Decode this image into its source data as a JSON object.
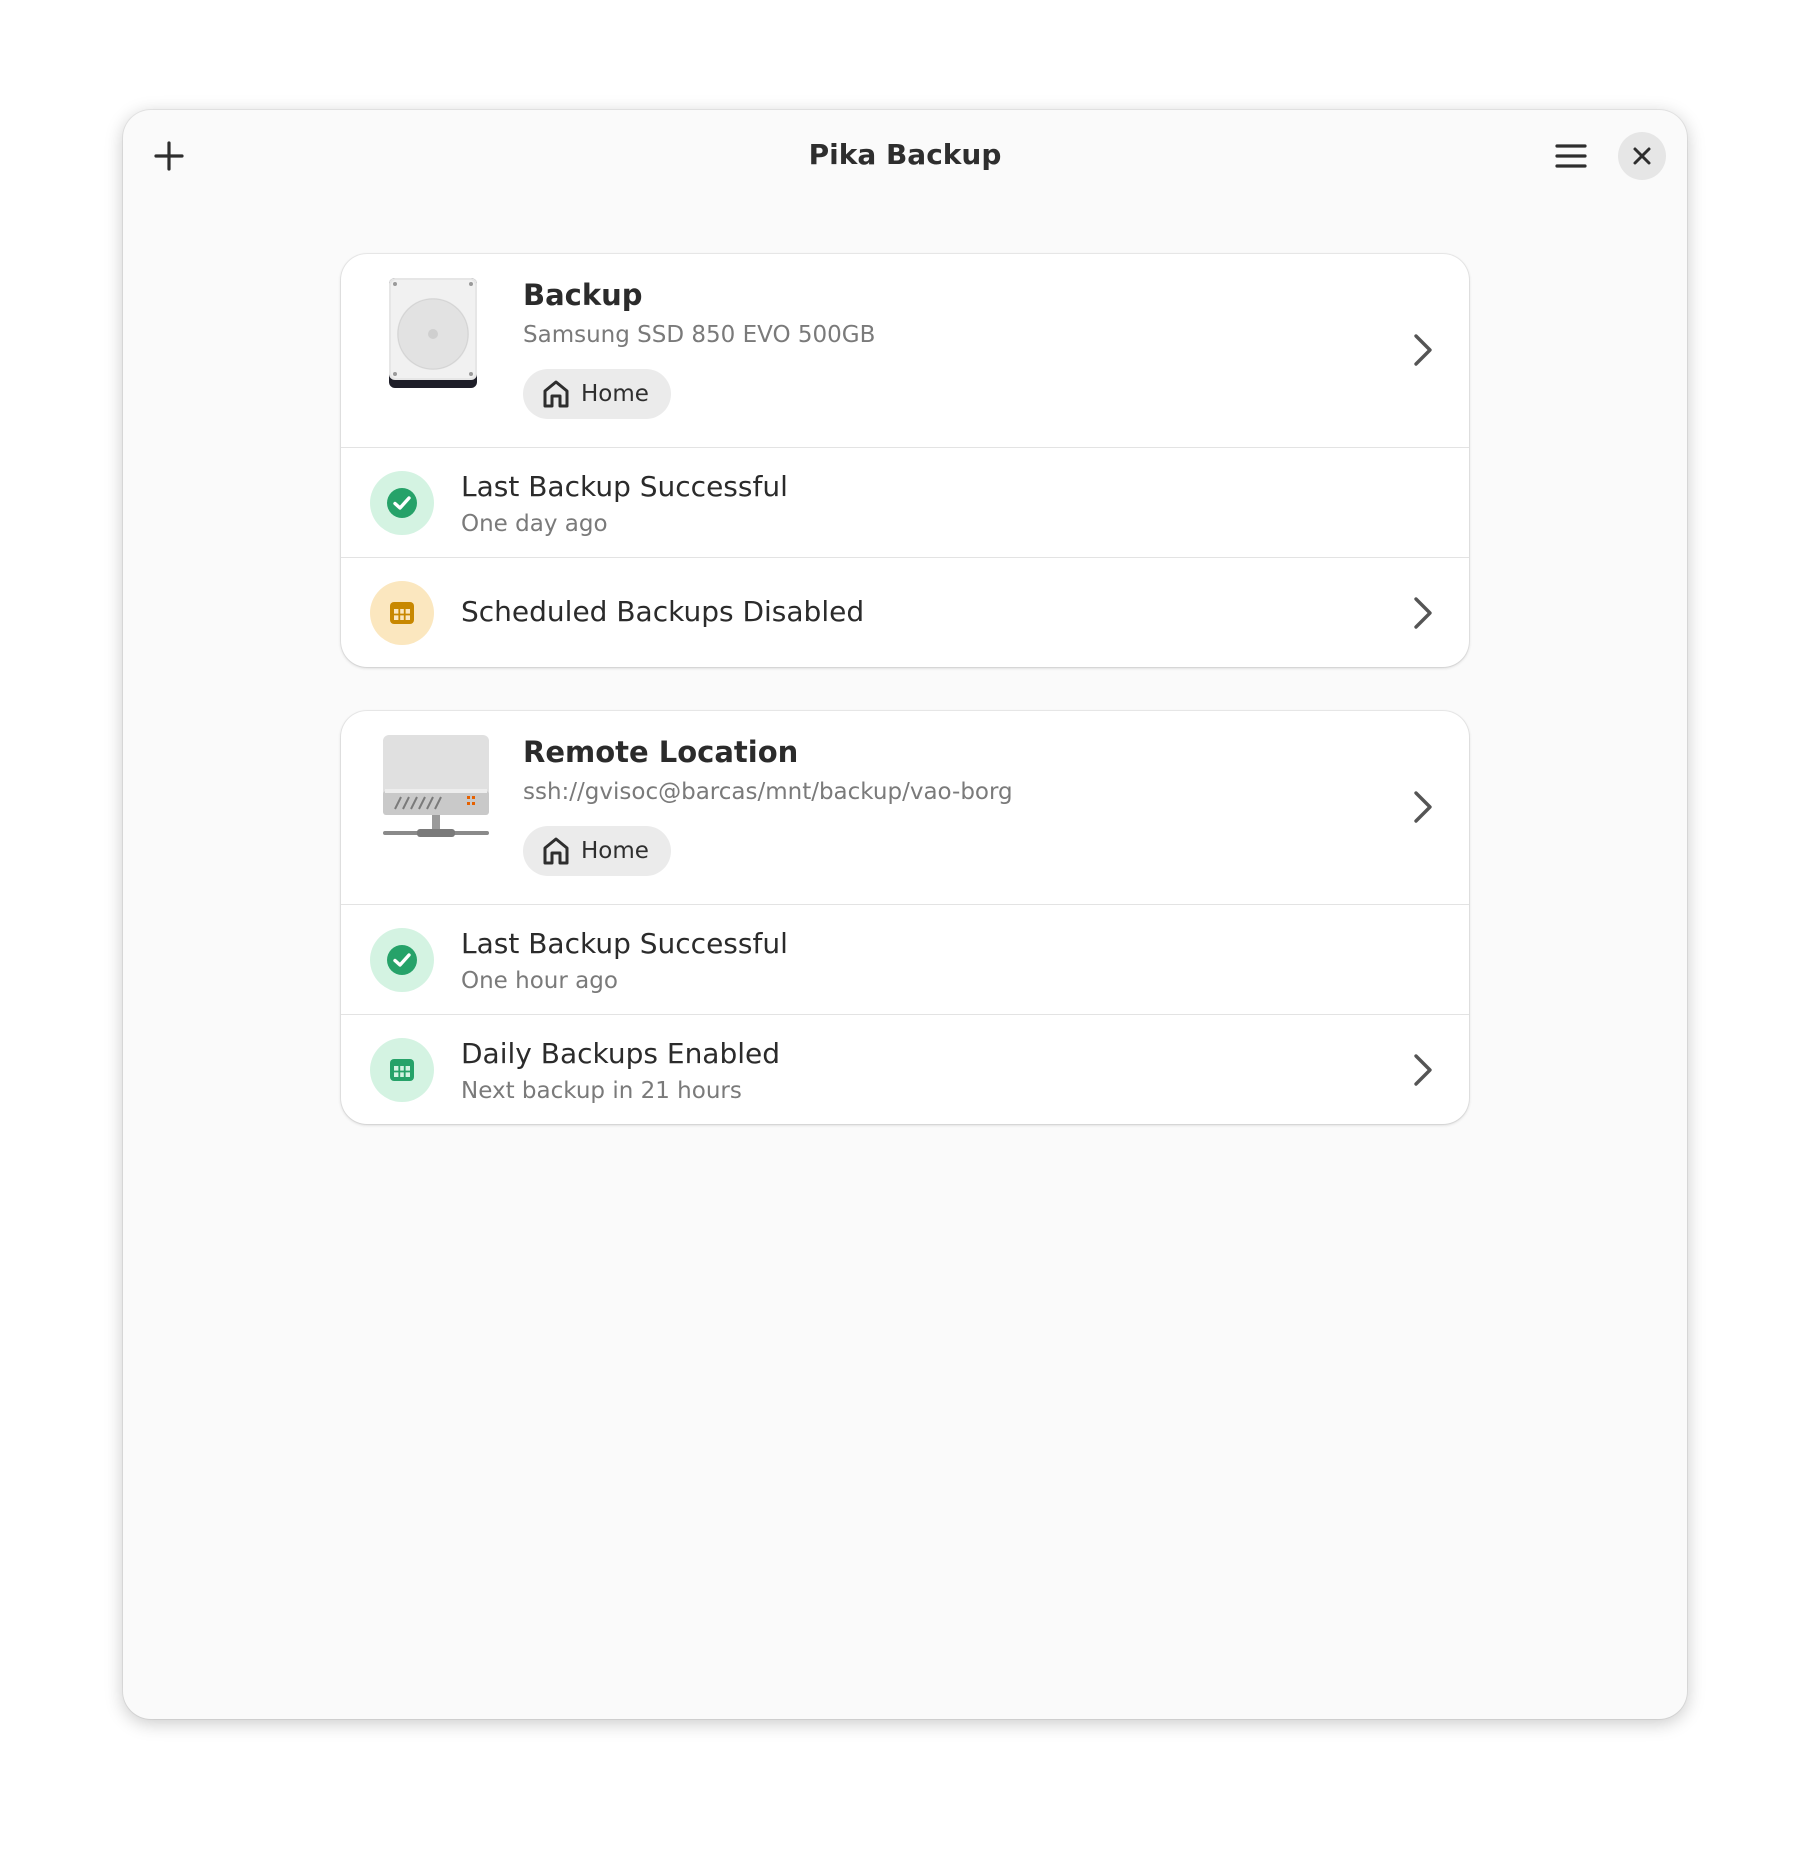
{
  "window": {
    "title": "Pika Backup"
  },
  "headerbar": {
    "add_icon": "plus-icon",
    "menu_icon": "hamburger-menu-icon",
    "close_icon": "close-icon"
  },
  "colors": {
    "success_green": "#26a269",
    "success_bg": "#d4f3e2",
    "warning_orange": "#c88800",
    "warning_bg": "#fbe7bf"
  },
  "repositories": [
    {
      "title": "Backup",
      "subtitle": "Samsung SSD 850 EVO 500GB",
      "icon": "hard-drive-icon",
      "include_label": "Home",
      "include_icon": "home-icon",
      "last_backup": {
        "title": "Last Backup Successful",
        "subtitle": "One day ago",
        "icon": "checkmark-icon"
      },
      "schedule": {
        "title": "Scheduled Backups Disabled",
        "icon": "calendar-icon"
      }
    },
    {
      "title": "Remote Location",
      "subtitle": "ssh://gvisoc@barcas/mnt/backup/vao-borg",
      "icon": "network-server-icon",
      "include_label": "Home",
      "include_icon": "home-icon",
      "last_backup": {
        "title": "Last Backup Successful",
        "subtitle": "One hour ago",
        "icon": "checkmark-icon"
      },
      "schedule": {
        "title": "Daily Backups Enabled",
        "subtitle": "Next backup in 21 hours",
        "icon": "calendar-icon"
      }
    }
  ]
}
